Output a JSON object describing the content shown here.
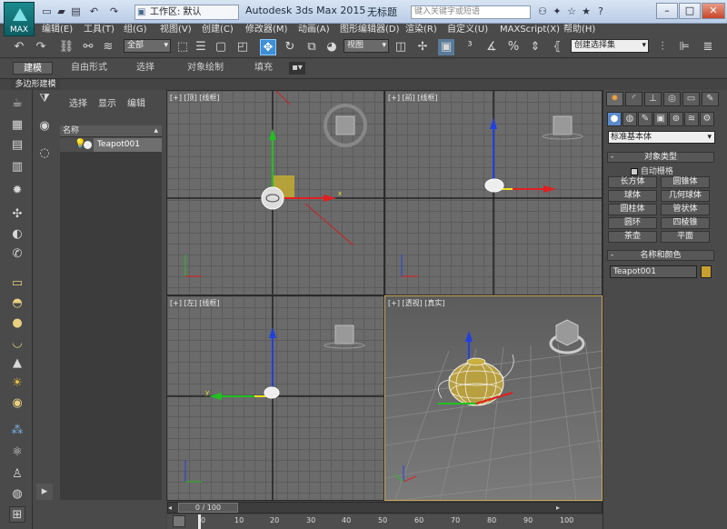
{
  "title_bar": {
    "logo_label": "MAX",
    "workspace_value": "工作区: 默认",
    "app_title": "Autodesk 3ds Max  2015",
    "doc_title": "无标题",
    "search_placeholder": "键入关键字或短语"
  },
  "menu": [
    "编辑(E)",
    "工具(T)",
    "组(G)",
    "视图(V)",
    "创建(C)",
    "修改器(M)",
    "动画(A)",
    "图形编辑器(D)",
    "渲染(R)",
    "自定义(U)",
    "MAXScript(X)",
    "帮助(H)"
  ],
  "toolbar": {
    "selection_filter": "全部",
    "ref_coord": "视图",
    "selection_set": "创建选择集"
  },
  "ribbon": {
    "tabs": [
      "建模",
      "自由形式",
      "选择",
      "对象绘制",
      "填充"
    ],
    "active_tab": "建模",
    "group": "多边形建模"
  },
  "scene_explorer": {
    "tabs": [
      "选择",
      "显示",
      "编辑"
    ],
    "column_header": "名称",
    "items": [
      {
        "name": "Teapot001"
      }
    ]
  },
  "viewports": [
    {
      "label": "[+] [顶] [线框]",
      "view": "top"
    },
    {
      "label": "[+] [前] [线框]",
      "view": "front"
    },
    {
      "label": "[+] [左] [线框]",
      "view": "left"
    },
    {
      "label": "[+] [透视] [真实]",
      "view": "perspective"
    }
  ],
  "command_panel": {
    "category": "标准基本体",
    "object_type_title": "对象类型",
    "autogrid_label": "自动栅格",
    "object_buttons": [
      "长方体",
      "圆锥体",
      "球体",
      "几何球体",
      "圆柱体",
      "管状体",
      "圆环",
      "四棱锥",
      "茶壶",
      "平面"
    ],
    "name_color_title": "名称和颜色",
    "object_name": "Teapot001",
    "object_color": "#c8a030"
  },
  "timeline": {
    "slider_label": "0 / 100",
    "ticks": [
      "0",
      "10",
      "20",
      "30",
      "40",
      "50",
      "60",
      "70",
      "80",
      "90",
      "100"
    ]
  },
  "colors": {
    "axis_x": "#e02020",
    "axis_y": "#20c020",
    "axis_z": "#2040e0",
    "selection": "#f0e020",
    "active_tool": "#3d8fd6"
  }
}
